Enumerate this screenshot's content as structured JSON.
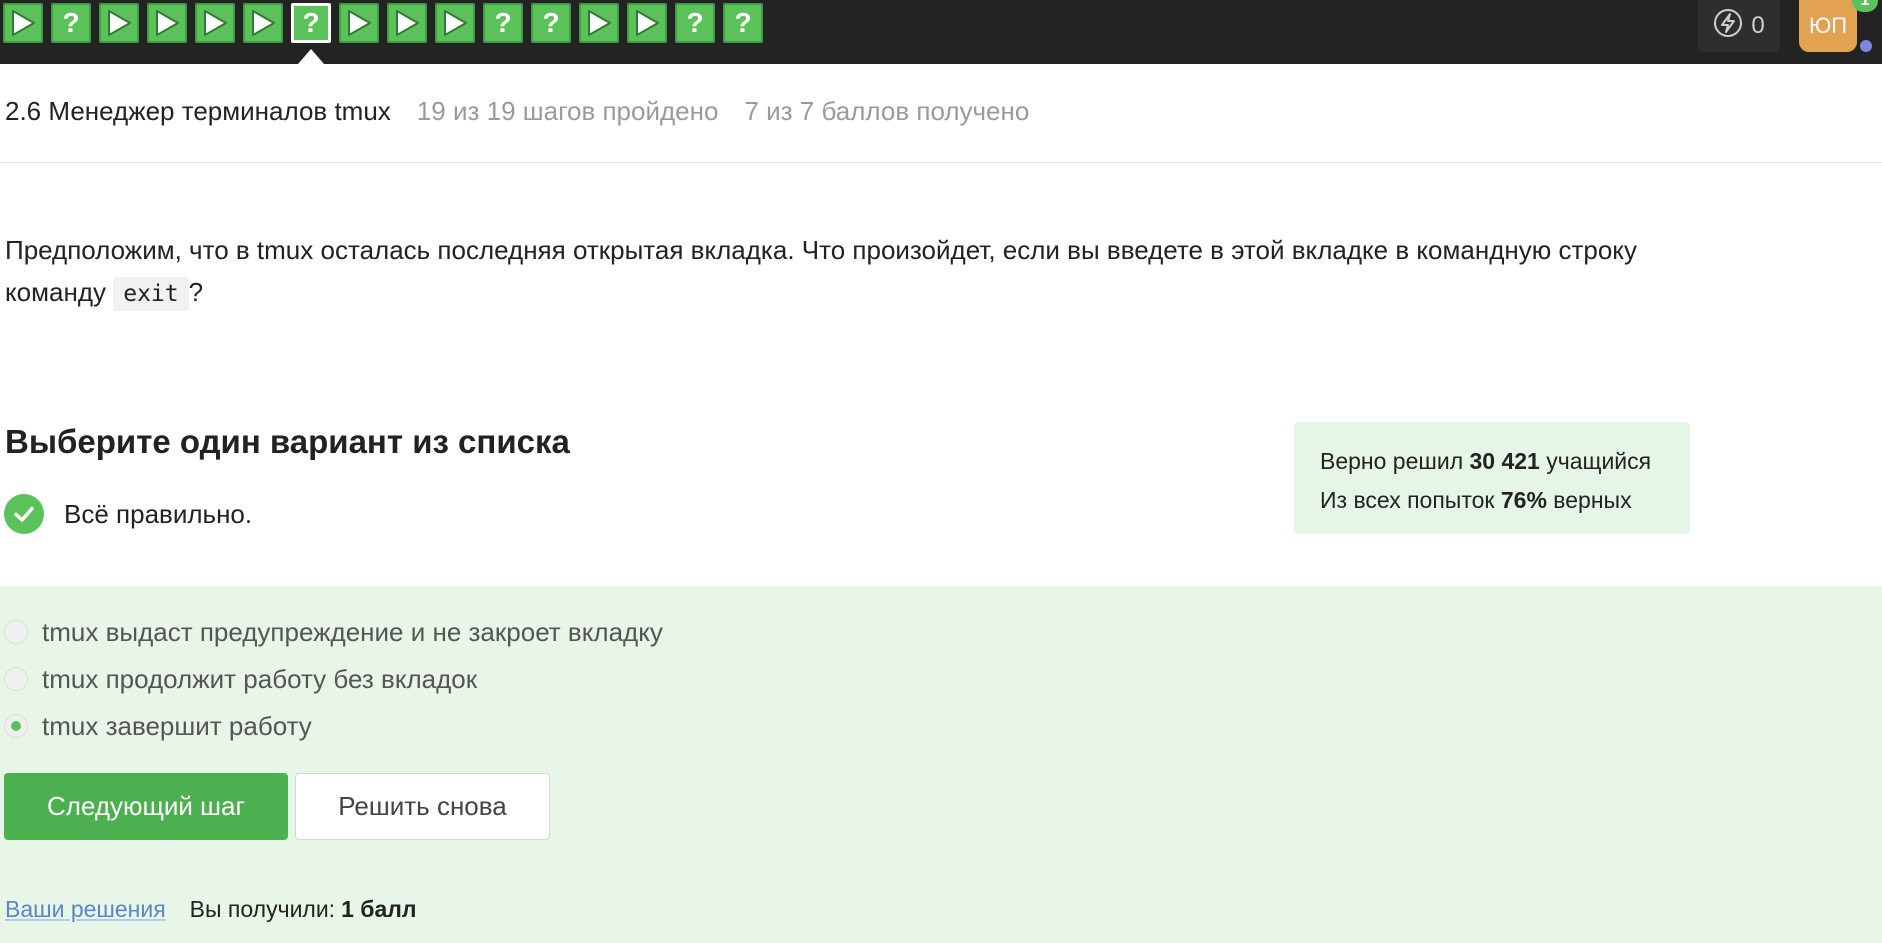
{
  "topbar": {
    "steps": [
      {
        "type": "play"
      },
      {
        "type": "quiz"
      },
      {
        "type": "play"
      },
      {
        "type": "play"
      },
      {
        "type": "play"
      },
      {
        "type": "play"
      },
      {
        "type": "quiz",
        "current": true
      },
      {
        "type": "play"
      },
      {
        "type": "play"
      },
      {
        "type": "play"
      },
      {
        "type": "quiz"
      },
      {
        "type": "quiz"
      },
      {
        "type": "play"
      },
      {
        "type": "play"
      },
      {
        "type": "quiz"
      },
      {
        "type": "quiz"
      }
    ],
    "quiz_glyph": "?",
    "energy_value": "0",
    "avatar_initials": "ЮП",
    "notification_count": "1"
  },
  "lesson": {
    "title": "2.6 Менеджер терминалов tmux",
    "steps_progress": "19 из 19 шагов пройдено",
    "points_progress": "7 из 7 баллов  получено"
  },
  "question": {
    "text_before": "Предположим, что в tmux осталась последняя открытая вкладка. Что произойдет, если вы введете в этой вкладке в командную строку команду ",
    "code": "exit",
    "text_after": "?"
  },
  "quiz": {
    "choose_title": "Выберите один вариант из списка",
    "result_text": "Всё правильно.",
    "stats": {
      "solved_prefix": "Верно решил ",
      "solved_count": "30 421",
      "solved_suffix": " учащийся",
      "attempts_prefix": "Из всех попыток ",
      "attempts_percent": "76%",
      "attempts_suffix": " верных"
    },
    "options": [
      {
        "label": "tmux выдаст предупреждение и не закроет вкладку",
        "selected": false
      },
      {
        "label": "tmux продолжит работу без вкладок",
        "selected": false
      },
      {
        "label": "tmux завершит работу",
        "selected": true
      }
    ],
    "next_button": "Следующий шаг",
    "retry_button": "Решить снова",
    "solutions_link": "Ваши решения",
    "score_label": "Вы получили:",
    "score_value": "1 балл"
  },
  "colors": {
    "step_green": "#5bc25b",
    "topbar_bg": "#232323",
    "answer_bg": "#e7f6e7",
    "button_green": "#4caf50",
    "avatar_orange": "#e3a252",
    "link_blue": "#5b86c8"
  }
}
